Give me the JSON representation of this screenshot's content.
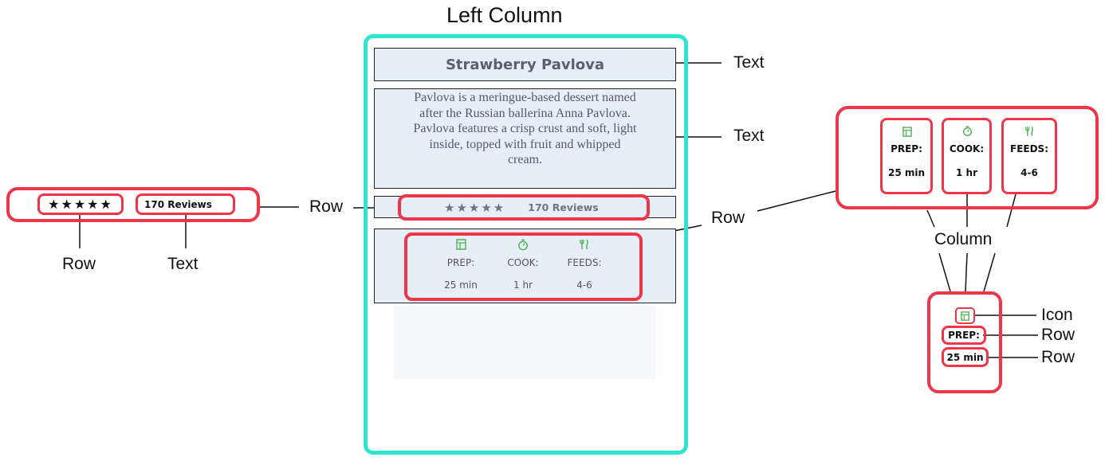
{
  "diagram": {
    "title": "Left Column",
    "labels": {
      "text_title": "Text",
      "text_desc": "Text",
      "row_reviews": "Row",
      "row_meta": "Row",
      "column": "Column",
      "icon": "Icon",
      "row_prep": "Row",
      "row_time": "Row",
      "left_row": "Row",
      "left_text": "Text"
    }
  },
  "recipe": {
    "title": "Strawberry Pavlova",
    "description": "Pavlova is a meringue-based dessert named after the Russian ballerina Anna Pavlova. Pavlova features a crisp crust and soft, light inside, topped with fruit and whipped cream.",
    "stars": "★★★★★",
    "reviews": "170 Reviews",
    "meta": [
      {
        "icon": "timer-box-icon",
        "label": "PREP:",
        "value": "25 min"
      },
      {
        "icon": "stopwatch-icon",
        "label": "COOK:",
        "value": "1 hr"
      },
      {
        "icon": "fork-knife-icon",
        "label": "FEEDS:",
        "value": "4-6"
      }
    ]
  },
  "colors": {
    "highlight_red": "#ef3648",
    "column_teal": "#2ee6cf",
    "panel_blue": "#e6eef8",
    "icon_green": "#4cb050"
  }
}
